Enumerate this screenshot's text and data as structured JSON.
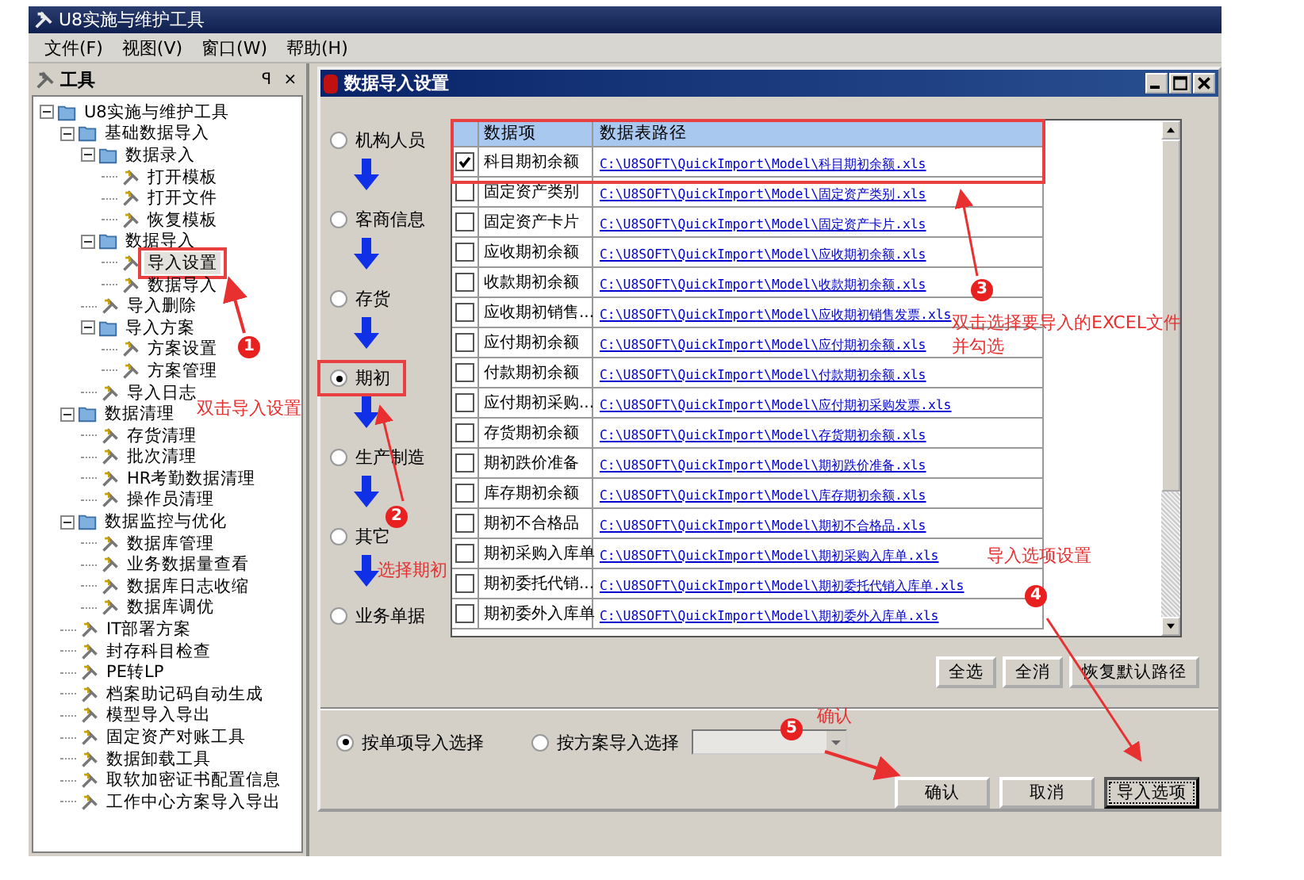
{
  "app": {
    "title": "U8实施与维护工具",
    "menu": [
      "文件(F)",
      "视图(V)",
      "窗口(W)",
      "帮助(H)"
    ]
  },
  "tool_panel": {
    "title": "工具",
    "pin": "ꟼ",
    "close": "×",
    "tree": [
      {
        "label": "U8实施与维护工具",
        "kind": "folder",
        "expanded": true,
        "selected": false,
        "children": [
          {
            "label": "基础数据导入",
            "kind": "folder",
            "expanded": true,
            "selected": false,
            "children": [
              {
                "label": "数据录入",
                "kind": "folder",
                "expanded": true,
                "selected": false,
                "children": [
                  {
                    "label": "打开模板",
                    "kind": "tool",
                    "selected": false
                  },
                  {
                    "label": "打开文件",
                    "kind": "tool",
                    "selected": false
                  },
                  {
                    "label": "恢复模板",
                    "kind": "tool",
                    "selected": false
                  }
                ]
              },
              {
                "label": "数据导入",
                "kind": "folder",
                "expanded": true,
                "selected": false,
                "children": [
                  {
                    "label": "导入设置",
                    "kind": "tool",
                    "selected": true
                  },
                  {
                    "label": "数据导入",
                    "kind": "tool",
                    "selected": false
                  }
                ]
              },
              {
                "label": "导入删除",
                "kind": "tool",
                "selected": false
              },
              {
                "label": "导入方案",
                "kind": "folder",
                "expanded": true,
                "selected": false,
                "children": [
                  {
                    "label": "方案设置",
                    "kind": "tool",
                    "selected": false
                  },
                  {
                    "label": "方案管理",
                    "kind": "tool",
                    "selected": false
                  }
                ]
              },
              {
                "label": "导入日志",
                "kind": "tool",
                "selected": false
              }
            ]
          },
          {
            "label": "数据清理",
            "kind": "folder",
            "expanded": true,
            "selected": false,
            "children": [
              {
                "label": "存货清理",
                "kind": "tool",
                "selected": false
              },
              {
                "label": "批次清理",
                "kind": "tool",
                "selected": false
              },
              {
                "label": "HR考勤数据清理",
                "kind": "tool",
                "selected": false
              },
              {
                "label": "操作员清理",
                "kind": "tool",
                "selected": false
              }
            ]
          },
          {
            "label": "数据监控与优化",
            "kind": "folder",
            "expanded": true,
            "selected": false,
            "children": [
              {
                "label": "数据库管理",
                "kind": "tool",
                "selected": false
              },
              {
                "label": "业务数据量查看",
                "kind": "tool",
                "selected": false
              },
              {
                "label": "数据库日志收缩",
                "kind": "tool",
                "selected": false
              },
              {
                "label": "数据库调优",
                "kind": "tool",
                "selected": false
              }
            ]
          },
          {
            "label": "IT部署方案",
            "kind": "tool",
            "selected": false
          },
          {
            "label": "封存科目检查",
            "kind": "tool",
            "selected": false
          },
          {
            "label": "PE转LP",
            "kind": "tool",
            "selected": false
          },
          {
            "label": "档案助记码自动生成",
            "kind": "tool",
            "selected": false
          },
          {
            "label": "模型导入导出",
            "kind": "tool",
            "selected": false
          },
          {
            "label": "固定资产对账工具",
            "kind": "tool",
            "selected": false
          },
          {
            "label": "数据卸载工具",
            "kind": "tool",
            "selected": false
          },
          {
            "label": "取软加密证书配置信息",
            "kind": "tool",
            "selected": false
          },
          {
            "label": "工作中心方案导入导出",
            "kind": "tool",
            "selected": false
          }
        ]
      }
    ]
  },
  "dialog": {
    "title": "数据导入设置",
    "categories": [
      {
        "label": "机构人员",
        "selected": false
      },
      {
        "label": "客商信息",
        "selected": false
      },
      {
        "label": "存货",
        "selected": false
      },
      {
        "label": "期初",
        "selected": true
      },
      {
        "label": "生产制造",
        "selected": false
      },
      {
        "label": "其它",
        "selected": false
      },
      {
        "label": "业务单据",
        "selected": false
      }
    ],
    "table": {
      "columns": [
        "数据项",
        "数据表路径"
      ],
      "rows": [
        {
          "item": "科目期初余额",
          "path": "C:\\U8SOFT\\QuickImport\\Model\\科目期初余额.xls",
          "checked": true
        },
        {
          "item": "固定资产类别",
          "path": "C:\\U8SOFT\\QuickImport\\Model\\固定资产类别.xls",
          "checked": false
        },
        {
          "item": "固定资产卡片",
          "path": "C:\\U8SOFT\\QuickImport\\Model\\固定资产卡片.xls",
          "checked": false
        },
        {
          "item": "应收期初余额",
          "path": "C:\\U8SOFT\\QuickImport\\Model\\应收期初余额.xls",
          "checked": false
        },
        {
          "item": "收款期初余额",
          "path": "C:\\U8SOFT\\QuickImport\\Model\\收款期初余额.xls",
          "checked": false
        },
        {
          "item": "应收期初销售...",
          "path": "C:\\U8SOFT\\QuickImport\\Model\\应收期初销售发票.xls",
          "checked": false
        },
        {
          "item": "应付期初余额",
          "path": "C:\\U8SOFT\\QuickImport\\Model\\应付期初余额.xls",
          "checked": false
        },
        {
          "item": "付款期初余额",
          "path": "C:\\U8SOFT\\QuickImport\\Model\\付款期初余额.xls",
          "checked": false
        },
        {
          "item": "应付期初采购...",
          "path": "C:\\U8SOFT\\QuickImport\\Model\\应付期初采购发票.xls",
          "checked": false
        },
        {
          "item": "存货期初余额",
          "path": "C:\\U8SOFT\\QuickImport\\Model\\存货期初余额.xls",
          "checked": false
        },
        {
          "item": "期初跌价准备",
          "path": "C:\\U8SOFT\\QuickImport\\Model\\期初跌价准备.xls",
          "checked": false
        },
        {
          "item": "库存期初余额",
          "path": "C:\\U8SOFT\\QuickImport\\Model\\库存期初余额.xls",
          "checked": false
        },
        {
          "item": "期初不合格品",
          "path": "C:\\U8SOFT\\QuickImport\\Model\\期初不合格品.xls",
          "checked": false
        },
        {
          "item": "期初采购入库单",
          "path": "C:\\U8SOFT\\QuickImport\\Model\\期初采购入库单.xls",
          "checked": false
        },
        {
          "item": "期初委托代销...",
          "path": "C:\\U8SOFT\\QuickImport\\Model\\期初委托代销入库单.xls",
          "checked": false
        },
        {
          "item": "期初委外入库单",
          "path": "C:\\U8SOFT\\QuickImport\\Model\\期初委外入库单.xls",
          "checked": false
        }
      ]
    },
    "table_buttons": [
      "全选",
      "全消",
      "恢复默认路径"
    ],
    "modes": [
      {
        "label": "按单项导入选择",
        "selected": true
      },
      {
        "label": "按方案导入选择",
        "selected": false
      }
    ],
    "buttons": [
      {
        "label": "确认",
        "focused": false
      },
      {
        "label": "取消",
        "focused": false
      },
      {
        "label": "导入选项",
        "focused": true
      }
    ]
  },
  "annotations": [
    {
      "number": "1",
      "lines": [
        "双击导入设置"
      ]
    },
    {
      "number": "2",
      "lines": [
        "选择期初"
      ]
    },
    {
      "number": "3",
      "lines": [
        "双击选择要导入的EXCEL文件",
        "并勾选"
      ]
    },
    {
      "number": "4",
      "lines": [
        "导入选项设置"
      ]
    },
    {
      "number": "5",
      "lines": [
        "确认"
      ]
    }
  ]
}
